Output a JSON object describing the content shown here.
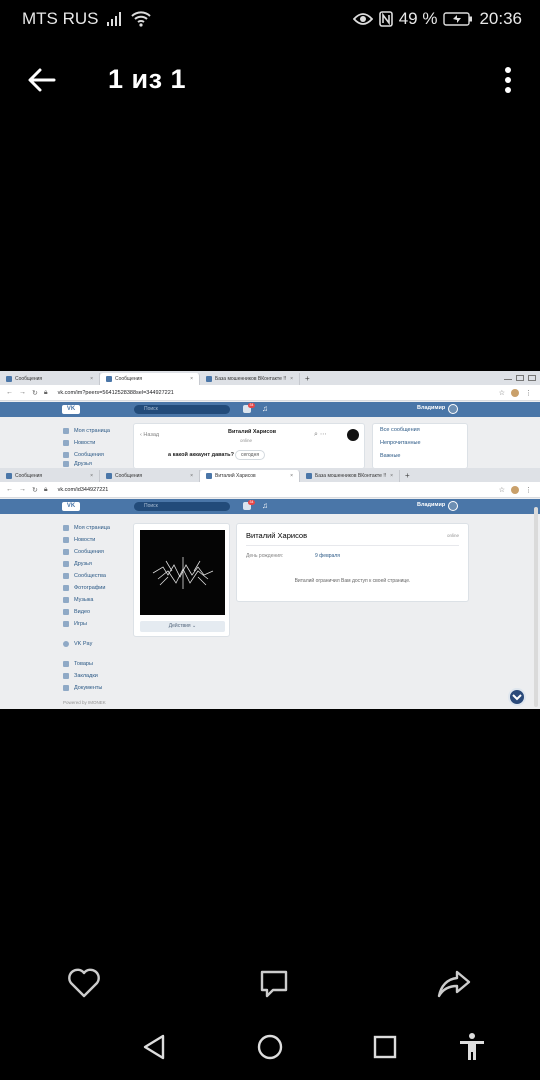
{
  "status_bar": {
    "carrier": "MTS RUS",
    "battery": "49 %",
    "time": "20:36",
    "icons": [
      "signal-icon",
      "wifi-icon",
      "eye-icon",
      "nfc-icon",
      "battery-icon"
    ]
  },
  "viewer": {
    "counter": "1 из 1",
    "icons": [
      "back-arrow-icon",
      "more-vert-icon"
    ]
  },
  "screenshot": {
    "top_window": {
      "tabs": [
        "Сообщения",
        "Сообщения",
        "База мошенников ВКонтакте !!"
      ],
      "url": "vk.com/im?peers=56412528388sel=344927221",
      "search_placeholder": "Поиск",
      "notif_count": "34",
      "user_name": "Владимир",
      "menu": [
        "Моя страница",
        "Новости",
        "Сообщения",
        "Друзья"
      ],
      "chat": {
        "back_label": "Назад",
        "contact_name": "Виталий Харисов",
        "status": "online",
        "message_text": "а какой аккаунт давать?",
        "date_chip": "сегодня"
      },
      "filters": [
        "Все сообщения",
        "Непрочитанные",
        "Важные"
      ]
    },
    "bottom_window": {
      "tabs": [
        "Сообщения",
        "Сообщения",
        "Виталий Харисов",
        "База мошенников ВКонтакте !!"
      ],
      "url": "vk.com/id344927221",
      "search_placeholder": "Поиск",
      "notif_count": "34",
      "user_name": "Владимир",
      "menu": [
        "Моя страница",
        "Новости",
        "Сообщения",
        "Друзья",
        "Сообщества",
        "Фотографии",
        "Музыка",
        "Видео",
        "Игры"
      ],
      "menu_extra": [
        "VK Pay"
      ],
      "menu_extra2": [
        "Товары",
        "Закладки",
        "Документы"
      ],
      "menu_footer": "Powered by IMONEK",
      "profile": {
        "name": "Виталий Харисов",
        "status": "online",
        "birthday_label": "День рождения:",
        "birthday_value": "9 февраля",
        "restricted_notice": "Виталий ограничил Вам доступ к своей странице.",
        "actions_label": "Действия"
      }
    }
  },
  "bottom_actions": [
    "heart-icon",
    "comment-icon",
    "share-icon"
  ],
  "nav_buttons": [
    "nav-back-icon",
    "nav-home-icon",
    "nav-recents-icon",
    "accessibility-icon"
  ]
}
